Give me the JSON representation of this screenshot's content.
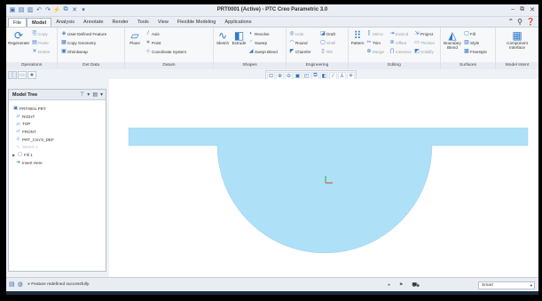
{
  "window": {
    "title": "PRT0001 (Active) - PTC Creo Parametric 3.0",
    "controls": [
      "–",
      "⧉",
      "✕"
    ]
  },
  "quick_access": [
    "new-icon",
    "open-icon",
    "save-icon",
    "undo-icon",
    "redo-icon",
    "regenerate-icon",
    "windows-icon",
    "close-window-icon",
    "customize-icon"
  ],
  "tabs": {
    "file": "File",
    "items": [
      "Model",
      "Analysis",
      "Annotate",
      "Render",
      "Tools",
      "View",
      "Flexible Modeling",
      "Applications"
    ],
    "active": "Model"
  },
  "ribbon": {
    "operations": {
      "label": "Operations",
      "regenerate": "Regenerate",
      "copy": "Copy",
      "paste": "Paste",
      "delete": "Delete"
    },
    "get_data": {
      "label": "Get Data",
      "udf": "User-Defined Feature",
      "copy_geometry": "Copy Geometry",
      "shrinkwrap": "Shrinkwrap"
    },
    "datum": {
      "label": "Datum",
      "plane": "Plane",
      "axis": "Axis",
      "point": "Point",
      "csys": "Coordinate System"
    },
    "shapes": {
      "label": "Shapes",
      "sketch": "Sketch",
      "extrude": "Extrude",
      "revolve": "Revolve",
      "sweep": "Sweep",
      "swept_blend": "Swept Blend"
    },
    "engineering": {
      "label": "Engineering",
      "hole": "Hole",
      "round": "Round",
      "chamfer": "Chamfer",
      "draft": "Draft",
      "shell": "Shell",
      "rib": "Rib"
    },
    "editing": {
      "label": "Editing",
      "pattern": "Pattern",
      "mirror": "Mirror",
      "trim": "Trim",
      "merge": "Merge",
      "extend": "Extend",
      "offset": "Offset",
      "intersect": "Intersect",
      "project": "Project",
      "thicken": "Thicken",
      "solidify": "Solidify"
    },
    "surfaces": {
      "label": "Surfaces",
      "boundary_blend": "Boundary Blend",
      "fill": "Fill",
      "style": "Style",
      "freestyle": "Freestyle"
    },
    "model_intent": {
      "label": "Model Intent",
      "component_interface": "Component Interface"
    }
  },
  "model_tree": {
    "title": "Model Tree",
    "items": [
      {
        "label": "PRT0001.PRT",
        "icon": "part-icon",
        "indent": 0
      },
      {
        "label": "RIGHT",
        "icon": "datum-plane-icon",
        "indent": 1
      },
      {
        "label": "TOP",
        "icon": "datum-plane-icon",
        "indent": 1
      },
      {
        "label": "FRONT",
        "icon": "datum-plane-icon",
        "indent": 1
      },
      {
        "label": "PRT_CSYS_DEF",
        "icon": "csys-icon",
        "indent": 1
      },
      {
        "label": "Sketch 1",
        "icon": "sketch-icon",
        "indent": 1,
        "faint": true
      },
      {
        "label": "Fill 1",
        "icon": "fill-icon",
        "indent": 1,
        "expandable": true
      },
      {
        "label": "Insert Here",
        "icon": "insert-here-icon",
        "indent": 1
      }
    ]
  },
  "graphics_toolbar": [
    "refit-icon",
    "zoom-in-icon",
    "zoom-out-icon",
    "repaint-icon",
    "reorient-icon",
    "saved-views-icon",
    "display-style-icon",
    "datum-display-icon",
    "annotation-display-icon",
    "spin-center-icon"
  ],
  "status": {
    "message": "Feature redefined successfully.",
    "selection_filter": "Smart"
  },
  "colors": {
    "surface_fill": "#aee0f8",
    "csys_x": "#e53935",
    "csys_y": "#2fae3a"
  }
}
